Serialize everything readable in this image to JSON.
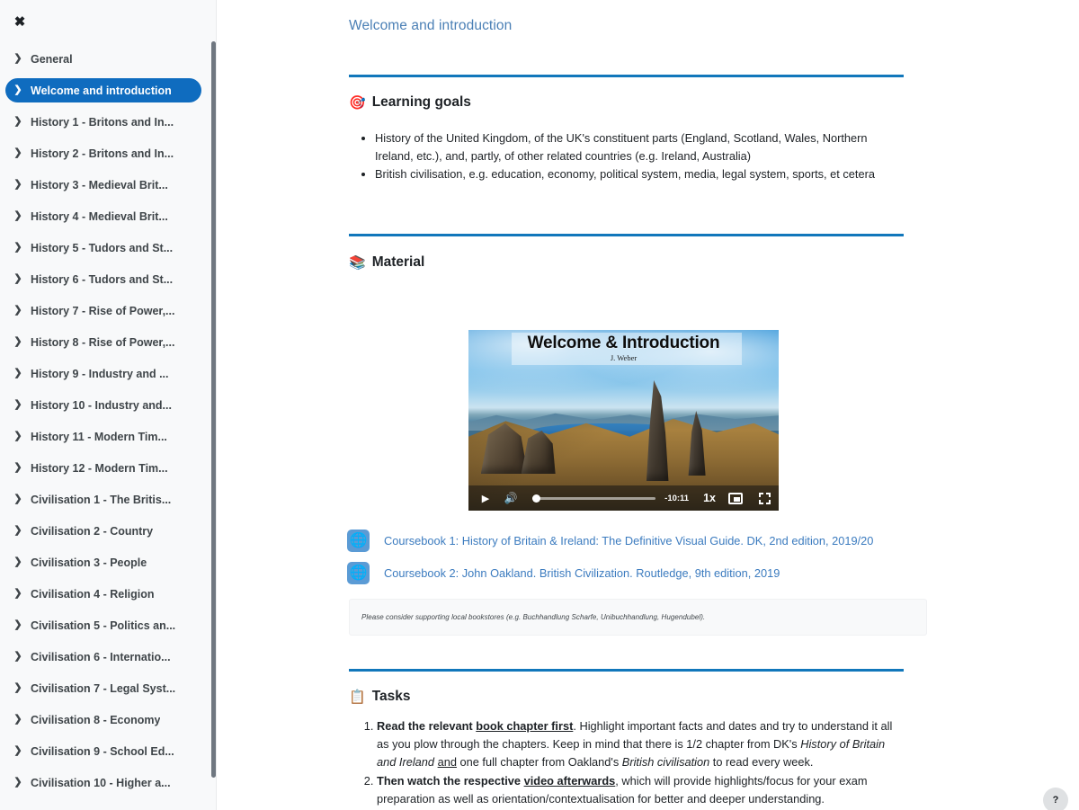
{
  "drawer": {
    "close_label": "✖",
    "chevron": "❯",
    "items": [
      {
        "label": "General",
        "active": false
      },
      {
        "label": "Welcome and introduction",
        "active": true
      },
      {
        "label": "History 1 - Britons and In...",
        "active": false
      },
      {
        "label": "History 2 - Britons and In...",
        "active": false
      },
      {
        "label": "History 3 - Medieval Brit...",
        "active": false
      },
      {
        "label": "History 4 - Medieval Brit...",
        "active": false
      },
      {
        "label": "History 5 - Tudors and St...",
        "active": false
      },
      {
        "label": "History 6 - Tudors and St...",
        "active": false
      },
      {
        "label": "History 7 - Rise of Power,...",
        "active": false
      },
      {
        "label": "History 8 - Rise of Power,...",
        "active": false
      },
      {
        "label": "History 9 - Industry and ...",
        "active": false
      },
      {
        "label": "History 10 - Industry and...",
        "active": false
      },
      {
        "label": "History 11 - Modern Tim...",
        "active": false
      },
      {
        "label": "History 12 - Modern Tim...",
        "active": false
      },
      {
        "label": "Civilisation 1 - The Britis...",
        "active": false
      },
      {
        "label": "Civilisation 2 - Country",
        "active": false
      },
      {
        "label": "Civilisation 3 - People",
        "active": false
      },
      {
        "label": "Civilisation 4 - Religion",
        "active": false
      },
      {
        "label": "Civilisation 5 - Politics an...",
        "active": false
      },
      {
        "label": "Civilisation 6 - Internatio...",
        "active": false
      },
      {
        "label": "Civilisation 7 - Legal Syst...",
        "active": false
      },
      {
        "label": "Civilisation 8 - Economy",
        "active": false
      },
      {
        "label": "Civilisation 9 - School Ed...",
        "active": false
      },
      {
        "label": "Civilisation 10 - Higher a...",
        "active": false
      }
    ]
  },
  "page": {
    "title": "Welcome and introduction"
  },
  "learning_goals": {
    "emoji": "🎯",
    "heading": "Learning goals",
    "bullets": [
      "History of the United Kingdom, of the UK's constituent parts (England, Scotland, Wales, Northern Ireland, etc.), and, partly, of other related countries (e.g. Ireland, Australia)",
      "British civilisation, e.g. education, economy, political system, media, legal system, sports, et cetera"
    ]
  },
  "material": {
    "emoji": "📚",
    "heading": "Material",
    "video": {
      "title": "Welcome & Introduction",
      "author": "J. Weber",
      "play_label": "▶",
      "volume_label": "🔊",
      "time_remaining": "-10:11",
      "speed": "1x"
    },
    "resources": [
      {
        "icon": "globe-icon",
        "label": "Coursebook 1: History of Britain & Ireland: The Definitive Visual Guide. DK, 2nd edition, 2019/20"
      },
      {
        "icon": "globe-icon",
        "label": "Coursebook 2: John Oakland. British Civilization. Routledge, 9th edition, 2019"
      }
    ],
    "note": "Please consider supporting local bookstores (e.g. Buchhandlung Scharfe, Unibuchhandlung, Hugendubel)."
  },
  "tasks": {
    "emoji": "📋",
    "heading": "Tasks",
    "items": [
      {
        "parts": [
          {
            "text": "Read the relevant ",
            "bold": true
          },
          {
            "text": "book chapter first",
            "bold": true,
            "underline": true
          },
          {
            "text": ". Highlight important facts and dates and try to understand it all as you plow through the chapters. Keep in mind that there is 1/2 chapter from DK's "
          },
          {
            "text": "History of Britain and Ireland",
            "italic": true
          },
          {
            "text": " "
          },
          {
            "text": "and",
            "underline": true
          },
          {
            "text": " one full chapter from Oakland's "
          },
          {
            "text": "British civilisation",
            "italic": true
          },
          {
            "text": " to read every week."
          }
        ]
      },
      {
        "parts": [
          {
            "text": "Then watch the respective ",
            "bold": true
          },
          {
            "text": "video afterwards",
            "bold": true,
            "underline": true
          },
          {
            "text": ", which will provide highlights/focus for your exam preparation as well as orientation/contextualisation for better and deeper understanding."
          }
        ]
      }
    ]
  },
  "help": {
    "label": "?"
  },
  "colors": {
    "accent_blue": "#0f6cbf",
    "divider_blue": "#1177bb",
    "link_blue": "#3b7bbf",
    "title_blue": "#4a7fb5",
    "sidebar_bg": "#f8f9fa",
    "resource_icon_bg": "#5b9bd5"
  }
}
